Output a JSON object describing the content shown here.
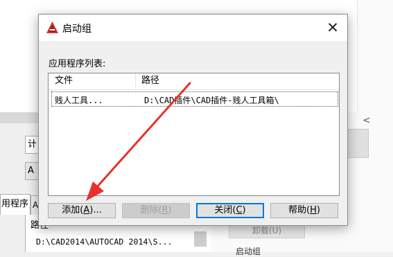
{
  "background": {
    "field1_text": "计",
    "field2_text": "A",
    "tab_label": "用程序",
    "tab2_text": "A",
    "list_header": "路径",
    "list_row": "D:\\CAD2014\\AUTOCAD 2014\\S...",
    "right_button": "卸载(U)",
    "right_text": "启动组",
    "chevron": "<"
  },
  "dialog": {
    "title": "启动组",
    "close_symbol": "✕",
    "list_caption": "应用程序列表:",
    "columns": {
      "file": "文件",
      "path": "路径"
    },
    "rows": [
      {
        "file": "贱人工具...",
        "path": "D:\\CAD插件\\CAD插件-贱人工具箱\\"
      }
    ],
    "buttons": {
      "add": {
        "text": "添加(",
        "mnemonic": "A",
        "suffix": ")..."
      },
      "remove": {
        "text": "删除(",
        "mnemonic": "R",
        "suffix": ")"
      },
      "close": {
        "text": "关闭(",
        "mnemonic": "C",
        "suffix": ")"
      },
      "help": {
        "text": "帮助(",
        "mnemonic": "H",
        "suffix": ")"
      }
    }
  },
  "colors": {
    "app_icon_red": "#d4322c",
    "arrow_red": "#e8312a",
    "focus_blue": "#0078d7"
  },
  "icons": [
    "autocad-app-icon",
    "close-icon",
    "annotation-arrow"
  ]
}
